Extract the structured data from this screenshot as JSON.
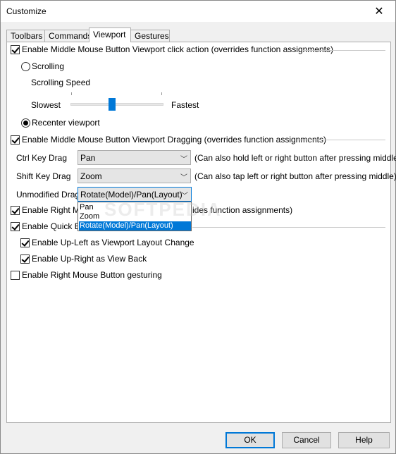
{
  "window": {
    "title": "Customize"
  },
  "tabs": [
    {
      "label": "Toolbars",
      "active": false
    },
    {
      "label": "Commands",
      "active": false
    },
    {
      "label": "Viewport",
      "active": true
    },
    {
      "label": "Gestures",
      "active": false
    }
  ],
  "viewport": {
    "middle_click": {
      "label": "Enable Middle Mouse Button Viewport click action (overrides function assignments)",
      "checked": true
    },
    "scrolling": {
      "label": "Scrolling",
      "checked": false
    },
    "scroll_speed_label": "Scrolling Speed",
    "slider": {
      "min_label": "Slowest",
      "max_label": "Fastest",
      "level": 0.5
    },
    "recenter": {
      "label": "Recenter viewport",
      "checked": true
    },
    "middle_drag": {
      "label": "Enable Middle Mouse Button Viewport Dragging (overrides function assignments)",
      "checked": true
    },
    "ctrl_drag": {
      "label": "Ctrl Key Drag",
      "value": "Pan",
      "note": "(Can also hold left or right button after pressing middle)"
    },
    "shift_drag": {
      "label": "Shift Key Drag",
      "value": "Zoom",
      "note": "(Can also tap left or right button after pressing middle)"
    },
    "unmodified_drag": {
      "label": "Unmodified Drag",
      "value": "Rotate(Model)/Pan(Layout)",
      "options": [
        "Pan",
        "Zoom",
        "Rotate(Model)/Pan(Layout)"
      ]
    },
    "right_mouse": {
      "label_start": "Enable Right Mou",
      "label_end": "ides function assignments)",
      "checked": true
    },
    "quick_eye": {
      "label": "Enable Quick Eye",
      "checked": true
    },
    "up_left": {
      "label": "Enable Up-Left as Viewport Layout Change",
      "checked": true
    },
    "up_right": {
      "label": "Enable Up-Right as View Back",
      "checked": true
    },
    "right_gesture": {
      "label": "Enable Right Mouse Button gesturing",
      "checked": false
    }
  },
  "buttons": {
    "ok": "OK",
    "cancel": "Cancel",
    "help": "Help"
  },
  "watermark": "SOFTPEDIA"
}
